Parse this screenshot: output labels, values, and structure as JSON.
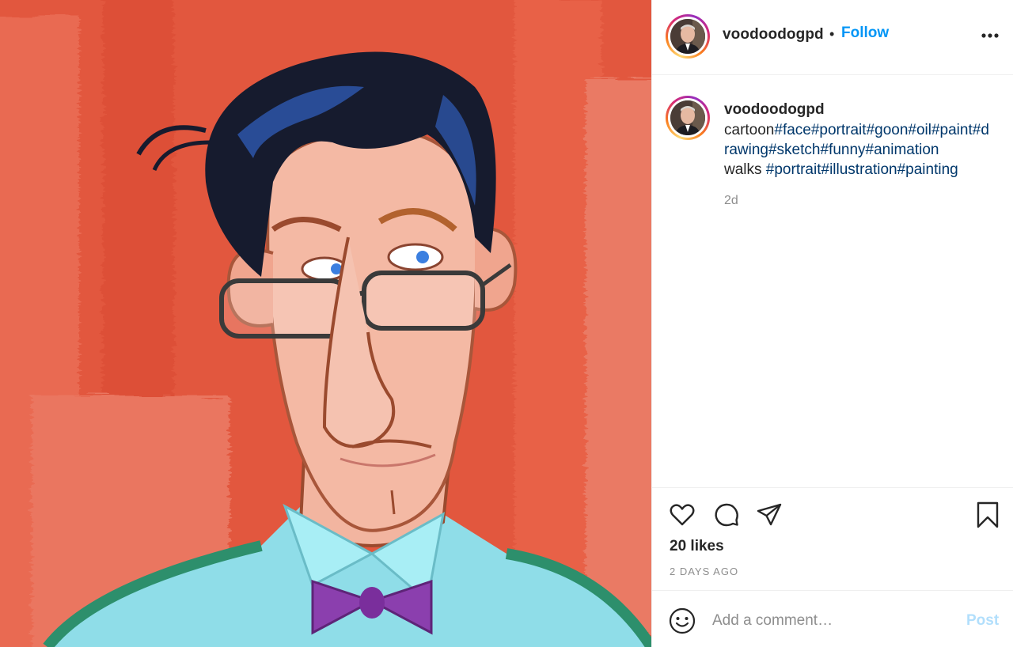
{
  "post": {
    "image_alt": "Painted caricature of a man with glasses and a purple bow tie",
    "username": "voodoodogpd",
    "follow_label": "Follow",
    "dot": "•",
    "more_icon": "more-horizontal-icon",
    "caption": {
      "username": "voodoodogpd",
      "plain": "cartoon",
      "hashtags": [
        "#face",
        "#portrait",
        "#goon",
        "#oil",
        "#paint",
        "#drawing",
        "#sketch",
        "#funny",
        "#animation"
      ],
      "plain2": "walks ",
      "hashtags2": [
        "#portrait",
        "#illustration",
        "#painting"
      ],
      "time": "2d"
    },
    "actions": {
      "like_icon": "heart-icon",
      "comment_icon": "comment-icon",
      "share_icon": "paper-plane-icon",
      "save_icon": "bookmark-icon"
    },
    "likes": "20 likes",
    "date": "2 DAYS AGO",
    "comment_box": {
      "emoji_icon": "smiley-icon",
      "placeholder": "Add a comment…",
      "post_label": "Post"
    },
    "colors": {
      "follow": "#0095f6",
      "hashtag": "#00376b",
      "post_disabled": "#b2dffc",
      "muted": "#8e8e8e",
      "background_paint": "#e2573e"
    }
  }
}
